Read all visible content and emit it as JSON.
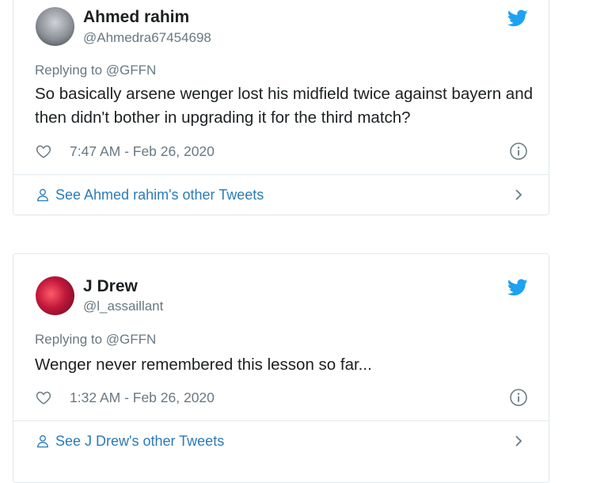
{
  "tweets": [
    {
      "author_name": "Ahmed rahim",
      "author_handle": "@Ahmedra67454698",
      "replying_to": "Replying to @GFFN",
      "text": "So basically arsene wenger lost his midfield twice against bayern and then didn't bother in upgrading it for the third match?",
      "timestamp": "7:47 AM - Feb 26, 2020",
      "see_more": "See Ahmed rahim's other Tweets"
    },
    {
      "author_name": "J Drew",
      "author_handle": "@l_assaillant",
      "replying_to": "Replying to @GFFN",
      "text": "Wenger never remembered this lesson so far...",
      "timestamp": "1:32 AM - Feb 26, 2020",
      "see_more": "See J Drew's other Tweets"
    }
  ],
  "colors": {
    "link": "#2b7bb9",
    "muted": "#697882",
    "twitter_blue": "#1da1f2",
    "border": "#e1e8ed"
  },
  "icons": [
    "twitter-bird-icon",
    "heart-icon",
    "info-icon",
    "person-icon",
    "chevron-right-icon"
  ]
}
